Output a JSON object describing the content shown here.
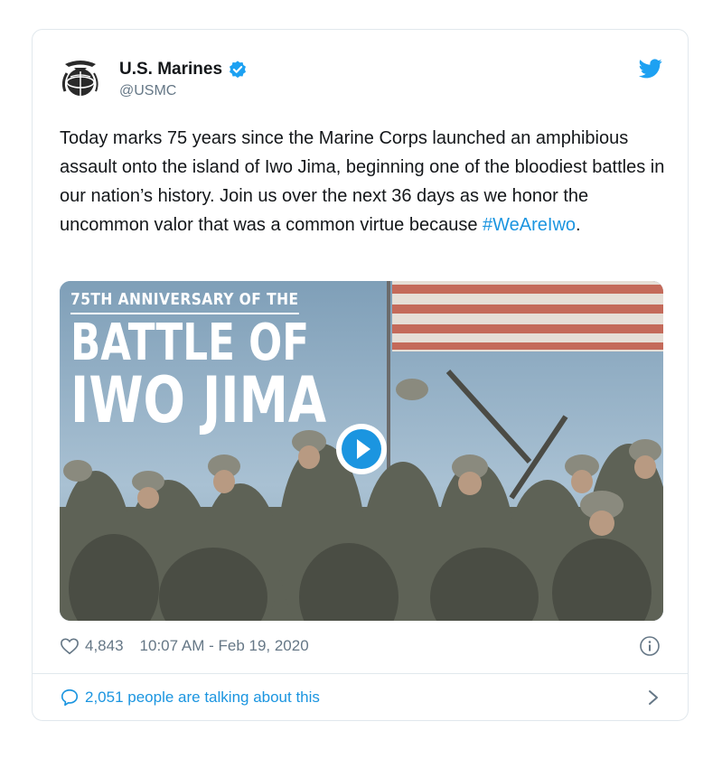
{
  "author": {
    "display_name": "U.S. Marines",
    "handle": "@USMC",
    "verified": true,
    "avatar_icon": "usmc-emblem-icon"
  },
  "tweet": {
    "text": "Today marks 75 years since the Marine Corps launched an amphibious assault onto the island of Iwo Jima, beginning one of the bloodiest battles in our nation’s history. Join us over the next 36 days as we honor the uncommon valor that was a common virtue because ",
    "hashtag": "#WeAreIwo",
    "trailing": "."
  },
  "media": {
    "overlay_subtitle": "75TH ANNIVERSARY OF THE",
    "overlay_line1": "BATTLE OF",
    "overlay_line2": "IWO JIMA",
    "play_icon": "play-icon"
  },
  "stats": {
    "likes": "4,843",
    "timestamp": "10:07 AM - Feb 19, 2020"
  },
  "footer": {
    "talking": "2,051 people are talking about this"
  },
  "colors": {
    "link": "#1b95e0",
    "muted": "#657786",
    "text": "#14171a",
    "border": "#e1e8ed"
  }
}
